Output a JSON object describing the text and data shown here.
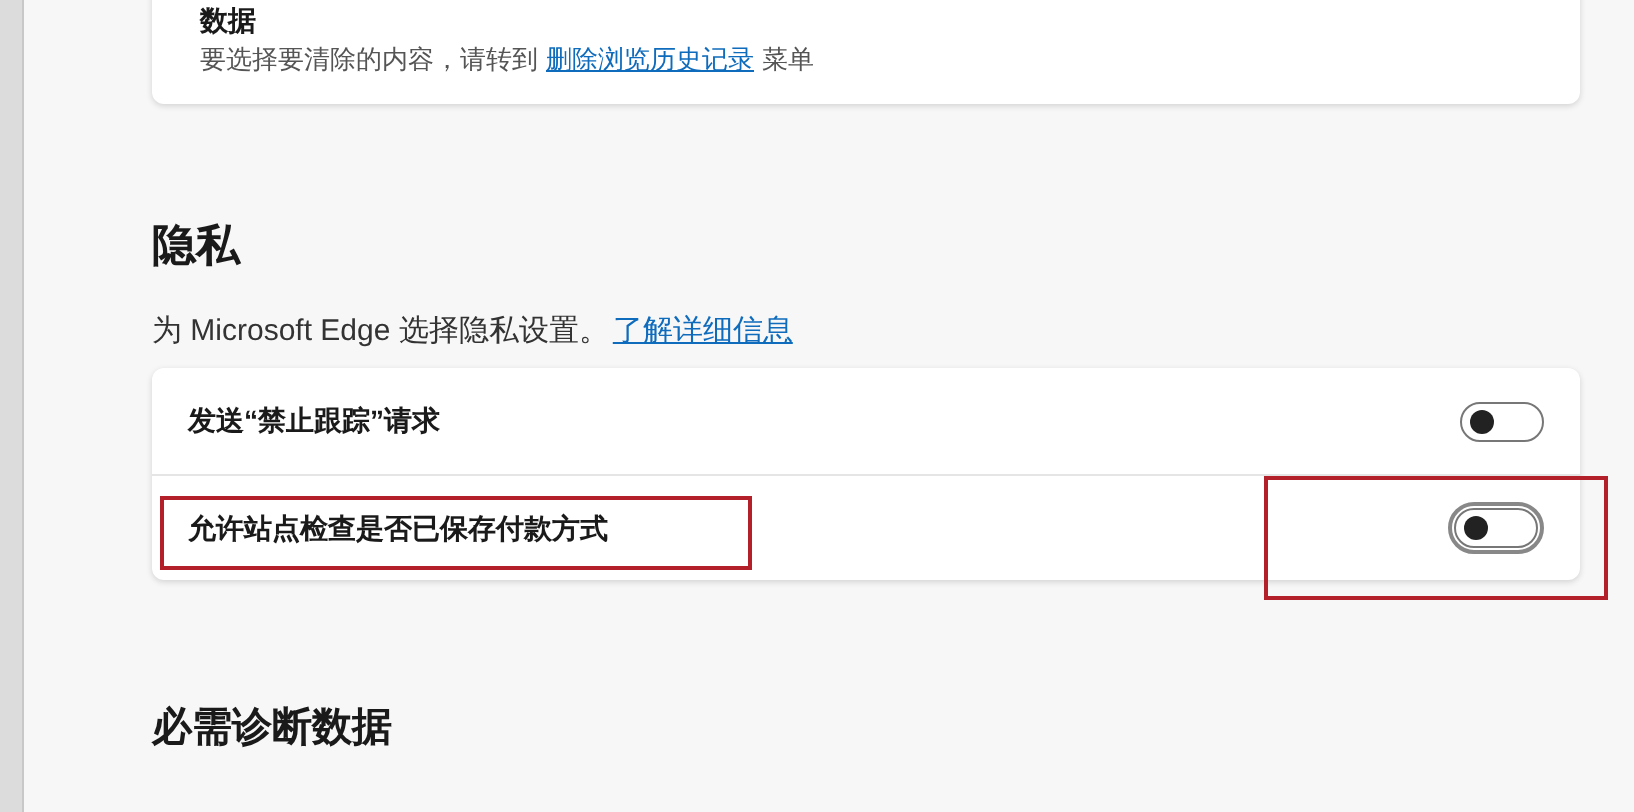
{
  "data_card": {
    "title": "数据",
    "text": "要选择要清除的内容，请转到",
    "link": "删除浏览历史记录",
    "text_after": "菜单"
  },
  "privacy": {
    "heading": "隐私",
    "description": "为 Microsoft Edge 选择隐私设置。",
    "link": "了解详细信息",
    "rows": [
      {
        "label": "发送“禁止跟踪”请求",
        "on": false,
        "focused": false,
        "highlighted": false
      },
      {
        "label": "允许站点检查是否已保存付款方式",
        "on": false,
        "focused": true,
        "highlighted": true
      }
    ]
  },
  "next_heading": "必需诊断数据"
}
